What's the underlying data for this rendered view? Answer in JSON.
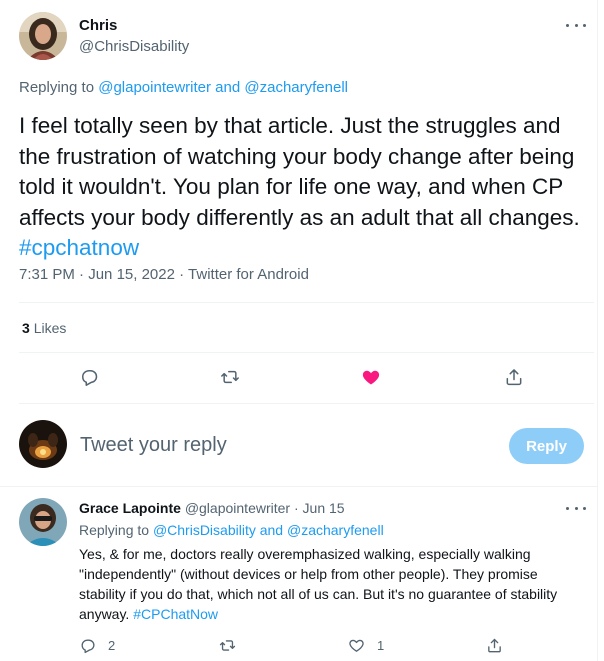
{
  "tweet": {
    "author_name": "Chris",
    "author_handle": "@ChrisDisability",
    "replying_prefix": "Replying to",
    "replying_to_1": "@glapointewriter",
    "replying_and": "and",
    "replying_to_2": "@zacharyfenell",
    "text": "I feel totally seen by that article. Just the struggles and the frustration of watching your body change after being told it wouldn't. You plan for life one way, and when CP affects your body differently as an adult that all changes.",
    "hashtag": "#cpchatnow",
    "time": "7:31 PM",
    "date": "Jun 15, 2022",
    "source": "Twitter for Android",
    "like_count": "3",
    "likes_label": "Likes",
    "icons": {
      "reply": "reply-icon",
      "retweet": "retweet-icon",
      "like": "heart-filled-icon",
      "share": "share-icon",
      "more": "more-icon"
    },
    "like_color": "#f91880"
  },
  "composer": {
    "placeholder": "Tweet your reply",
    "button_label": "Reply",
    "button_color": "#8ecdf8"
  },
  "reply": {
    "author_name": "Grace Lapointe",
    "author_handle": "@glapointewriter",
    "date": "Jun 15",
    "replying_prefix": "Replying to",
    "replying_to_1": "@ChrisDisability",
    "replying_and": "and",
    "replying_to_2": "@zacharyfenell",
    "text": "Yes, & for me, doctors really overemphasized walking, especially walking \"independently\" (without devices or help from other people). They promise stability if you do that, which not all of us can. But it's no guarantee of stability anyway.",
    "hashtag": "#CPChatNow",
    "reply_count": "2",
    "like_count": "1"
  },
  "colors": {
    "link": "#1d9bf0",
    "muted": "#536471",
    "text": "#0f1419"
  }
}
